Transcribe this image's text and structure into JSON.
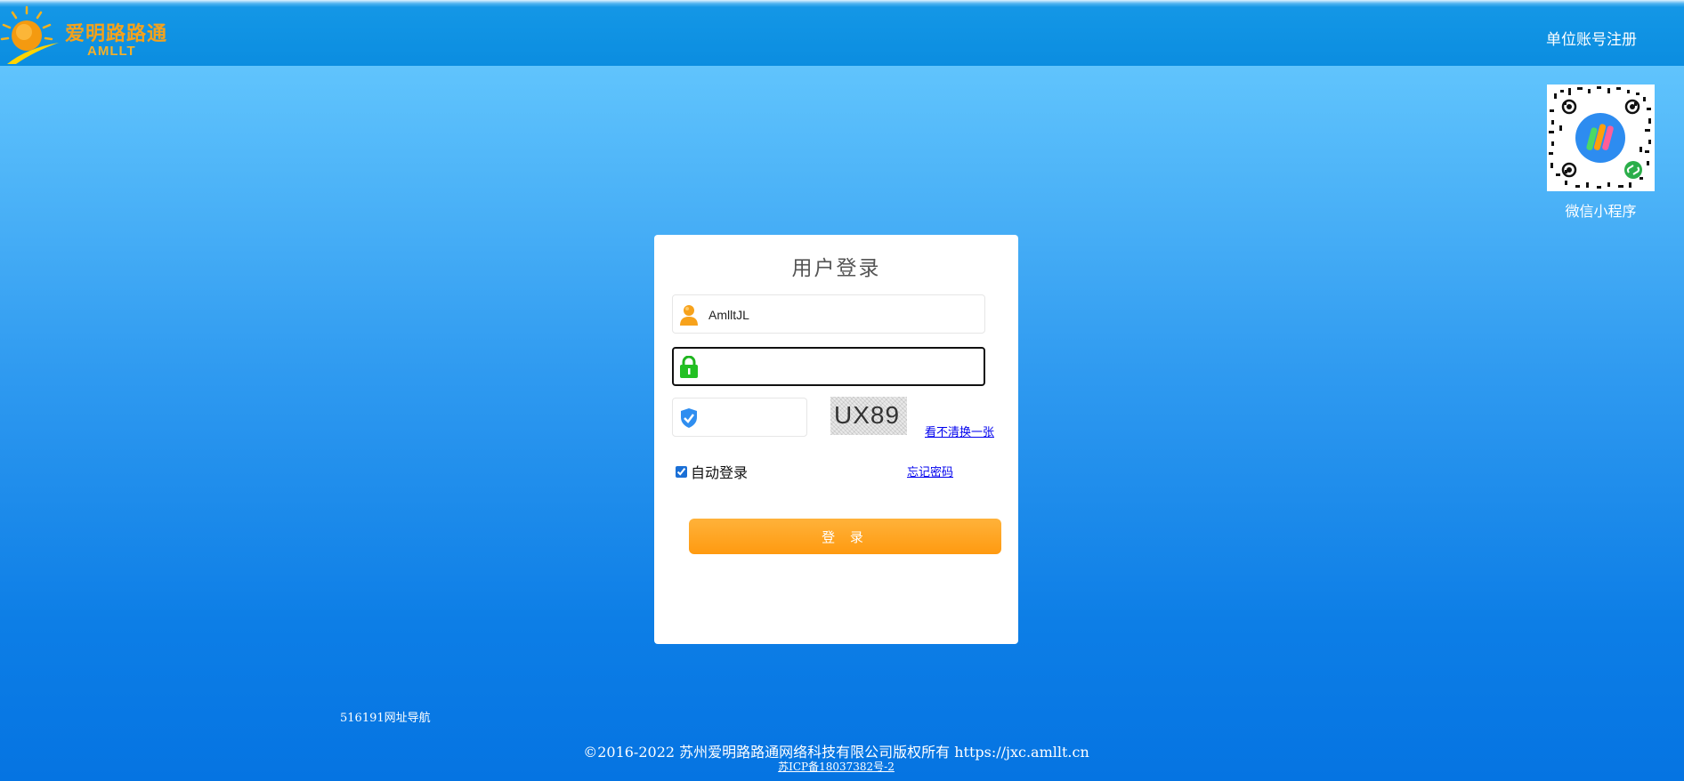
{
  "header": {
    "logo_cn": "爱明路路通",
    "logo_en": "AMLLT",
    "register_link": "单位账号注册"
  },
  "qr": {
    "caption": "微信小程序"
  },
  "login": {
    "title": "用户登录",
    "username_value": "AmlltJL",
    "password_value": "",
    "captcha_value": "",
    "captcha_text": "UX89",
    "refresh_link": "看不清换一张",
    "auto_login_label": "自动登录",
    "auto_login_checked": true,
    "forgot_link": "忘记密码",
    "submit_label": "登 录"
  },
  "footer": {
    "nav_link": "516191网址导航",
    "copyright": "©2016-2022 苏州爱明路路通网络科技有限公司版权所有 https://jxc.amllt.cn",
    "icp": "苏ICP备18037382号-2"
  },
  "colors": {
    "accent_button": "#ff9a10",
    "header_bg": "#0b8de0",
    "logo_orange": "#f4a21c"
  },
  "icons": [
    "sun-logo-icon",
    "user-icon",
    "lock-icon",
    "shield-check-icon",
    "qr-code-icon"
  ]
}
